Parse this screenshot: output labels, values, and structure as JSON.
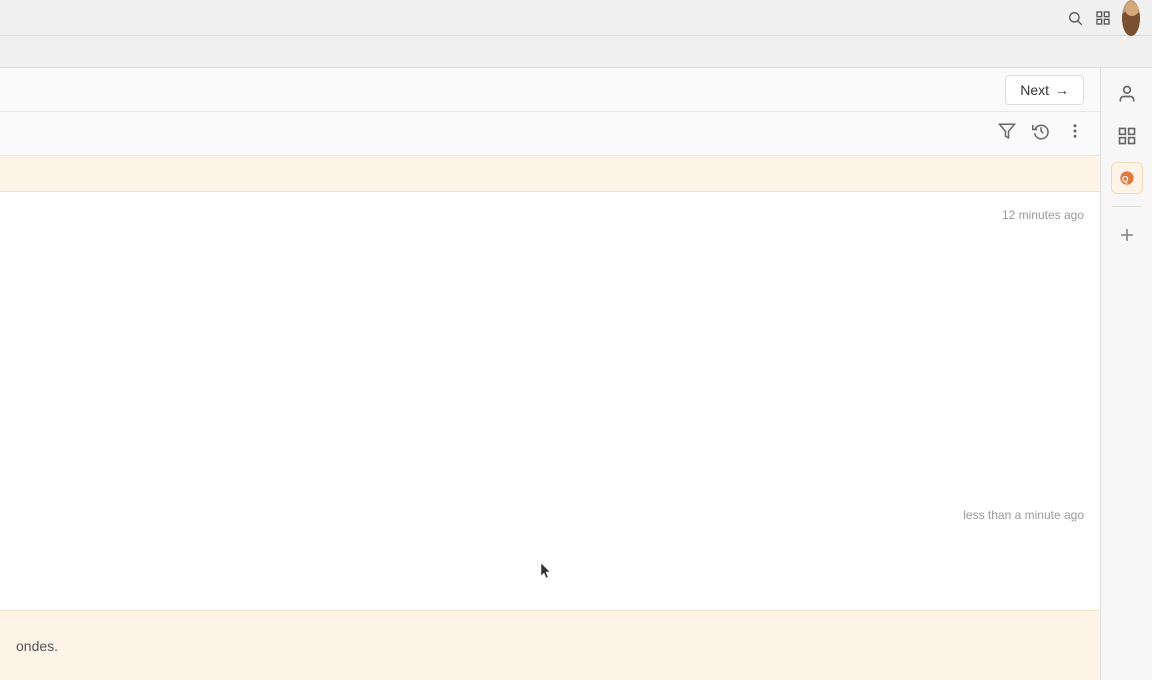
{
  "browser": {
    "icons": [
      "search",
      "grid",
      "avatar"
    ]
  },
  "toolbar": {
    "next_label": "Next",
    "next_arrow": "→"
  },
  "filter_toolbar": {
    "filter_icon": "⊜",
    "history_icon": "⟳",
    "more_icon": "⋯"
  },
  "chat": {
    "timestamp_1": "12 minutes ago",
    "timestamp_2": "less than a minute ago",
    "bottom_text": "ondes."
  },
  "sidebar": {
    "user_icon": "👤",
    "grid_icon": "⊞",
    "add_icon": "+"
  }
}
